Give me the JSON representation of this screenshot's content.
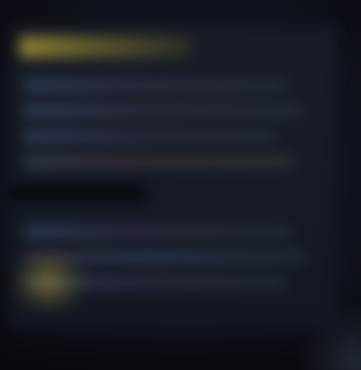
{
  "screen": {
    "theme_colors": {
      "background": "#0b0d13",
      "panel": "#151a24",
      "accent_gold": "#9a8a2e",
      "accent_blue": "#597daa",
      "accent_purple": "#67548b"
    }
  }
}
